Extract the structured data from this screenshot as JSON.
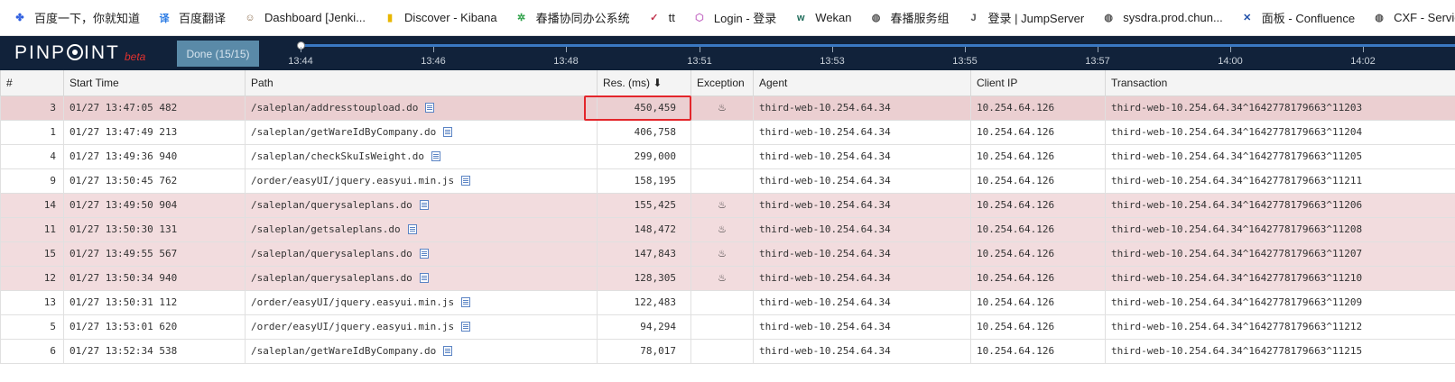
{
  "bookmarks": [
    {
      "label": "百度一下，你就知道",
      "icon": "paw-icon",
      "color": "#2f5fe0"
    },
    {
      "label": "百度翻译",
      "icon": "translate-icon",
      "color": "#2a7be4"
    },
    {
      "label": "Dashboard [Jenki...",
      "icon": "jenkins-icon",
      "color": "#8a6a4a"
    },
    {
      "label": "Discover - Kibana",
      "icon": "kibana-icon",
      "color": "#e8b600"
    },
    {
      "label": "春播协同办公系统",
      "icon": "gear-icon",
      "color": "#2fa24a"
    },
    {
      "label": "tt",
      "icon": "checkmark-icon",
      "color": "#c0304a"
    },
    {
      "label": "Login - 登录",
      "icon": "hexagon-icon",
      "color": "#c46bc4"
    },
    {
      "label": "Wekan",
      "icon": "wekan-icon",
      "color": "#1e6b5a"
    },
    {
      "label": "春播服务组",
      "icon": "globe-icon",
      "color": "#555555"
    },
    {
      "label": "登录 | JumpServer",
      "icon": "jumpserver-icon",
      "color": "#555555"
    },
    {
      "label": "sysdra.prod.chun...",
      "icon": "globe-icon",
      "color": "#555555"
    },
    {
      "label": "面板 - Confluence",
      "icon": "confluence-icon",
      "color": "#1f4fa8"
    },
    {
      "label": "CXF - Service list",
      "icon": "globe-icon",
      "color": "#555555"
    }
  ],
  "header": {
    "logo": "PINPOINT",
    "beta": "beta",
    "done_button": "Done (15/15)",
    "time_ticks": [
      "13:44",
      "13:46",
      "13:48",
      "13:51",
      "13:53",
      "13:55",
      "13:57",
      "14:00",
      "14:02"
    ]
  },
  "table": {
    "columns": [
      "#",
      "Start Time",
      "Path",
      "Res. (ms) ⬇",
      "Exception",
      "Agent",
      "Client IP",
      "Transaction"
    ],
    "rows": [
      {
        "num": "3",
        "start": "01/27 13:47:05 482",
        "path": "/saleplan/addresstoupload.do",
        "res": "450,459",
        "exception": true,
        "agent": "third-web-10.254.64.34",
        "ip": "10.254.64.126",
        "tx": "third-web-10.254.64.34^1642778179663^11203",
        "selected": true
      },
      {
        "num": "1",
        "start": "01/27 13:47:49 213",
        "path": "/saleplan/getWareIdByCompany.do",
        "res": "406,758",
        "exception": false,
        "agent": "third-web-10.254.64.34",
        "ip": "10.254.64.126",
        "tx": "third-web-10.254.64.34^1642778179663^11204",
        "selected": false
      },
      {
        "num": "4",
        "start": "01/27 13:49:36 940",
        "path": "/saleplan/checkSkuIsWeight.do",
        "res": "299,000",
        "exception": false,
        "agent": "third-web-10.254.64.34",
        "ip": "10.254.64.126",
        "tx": "third-web-10.254.64.34^1642778179663^11205",
        "selected": false
      },
      {
        "num": "9",
        "start": "01/27 13:50:45 762",
        "path": "/order/easyUI/jquery.easyui.min.js",
        "res": "158,195",
        "exception": false,
        "agent": "third-web-10.254.64.34",
        "ip": "10.254.64.126",
        "tx": "third-web-10.254.64.34^1642778179663^11211",
        "selected": false
      },
      {
        "num": "14",
        "start": "01/27 13:49:50 904",
        "path": "/saleplan/querysaleplans.do",
        "res": "155,425",
        "exception": true,
        "agent": "third-web-10.254.64.34",
        "ip": "10.254.64.126",
        "tx": "third-web-10.254.64.34^1642778179663^11206",
        "selected": false
      },
      {
        "num": "11",
        "start": "01/27 13:50:30 131",
        "path": "/saleplan/getsaleplans.do",
        "res": "148,472",
        "exception": true,
        "agent": "third-web-10.254.64.34",
        "ip": "10.254.64.126",
        "tx": "third-web-10.254.64.34^1642778179663^11208",
        "selected": false
      },
      {
        "num": "15",
        "start": "01/27 13:49:55 567",
        "path": "/saleplan/querysaleplans.do",
        "res": "147,843",
        "exception": true,
        "agent": "third-web-10.254.64.34",
        "ip": "10.254.64.126",
        "tx": "third-web-10.254.64.34^1642778179663^11207",
        "selected": false
      },
      {
        "num": "12",
        "start": "01/27 13:50:34 940",
        "path": "/saleplan/querysaleplans.do",
        "res": "128,305",
        "exception": true,
        "agent": "third-web-10.254.64.34",
        "ip": "10.254.64.126",
        "tx": "third-web-10.254.64.34^1642778179663^11210",
        "selected": false
      },
      {
        "num": "13",
        "start": "01/27 13:50:31 112",
        "path": "/order/easyUI/jquery.easyui.min.js",
        "res": "122,483",
        "exception": false,
        "agent": "third-web-10.254.64.34",
        "ip": "10.254.64.126",
        "tx": "third-web-10.254.64.34^1642778179663^11209",
        "selected": false
      },
      {
        "num": "5",
        "start": "01/27 13:53:01 620",
        "path": "/order/easyUI/jquery.easyui.min.js",
        "res": "94,294",
        "exception": false,
        "agent": "third-web-10.254.64.34",
        "ip": "10.254.64.126",
        "tx": "third-web-10.254.64.34^1642778179663^11212",
        "selected": false
      },
      {
        "num": "6",
        "start": "01/27 13:52:34 538",
        "path": "/saleplan/getWareIdByCompany.do",
        "res": "78,017",
        "exception": false,
        "agent": "third-web-10.254.64.34",
        "ip": "10.254.64.126",
        "tx": "third-web-10.254.64.34^1642778179663^11215",
        "selected": false
      }
    ]
  }
}
